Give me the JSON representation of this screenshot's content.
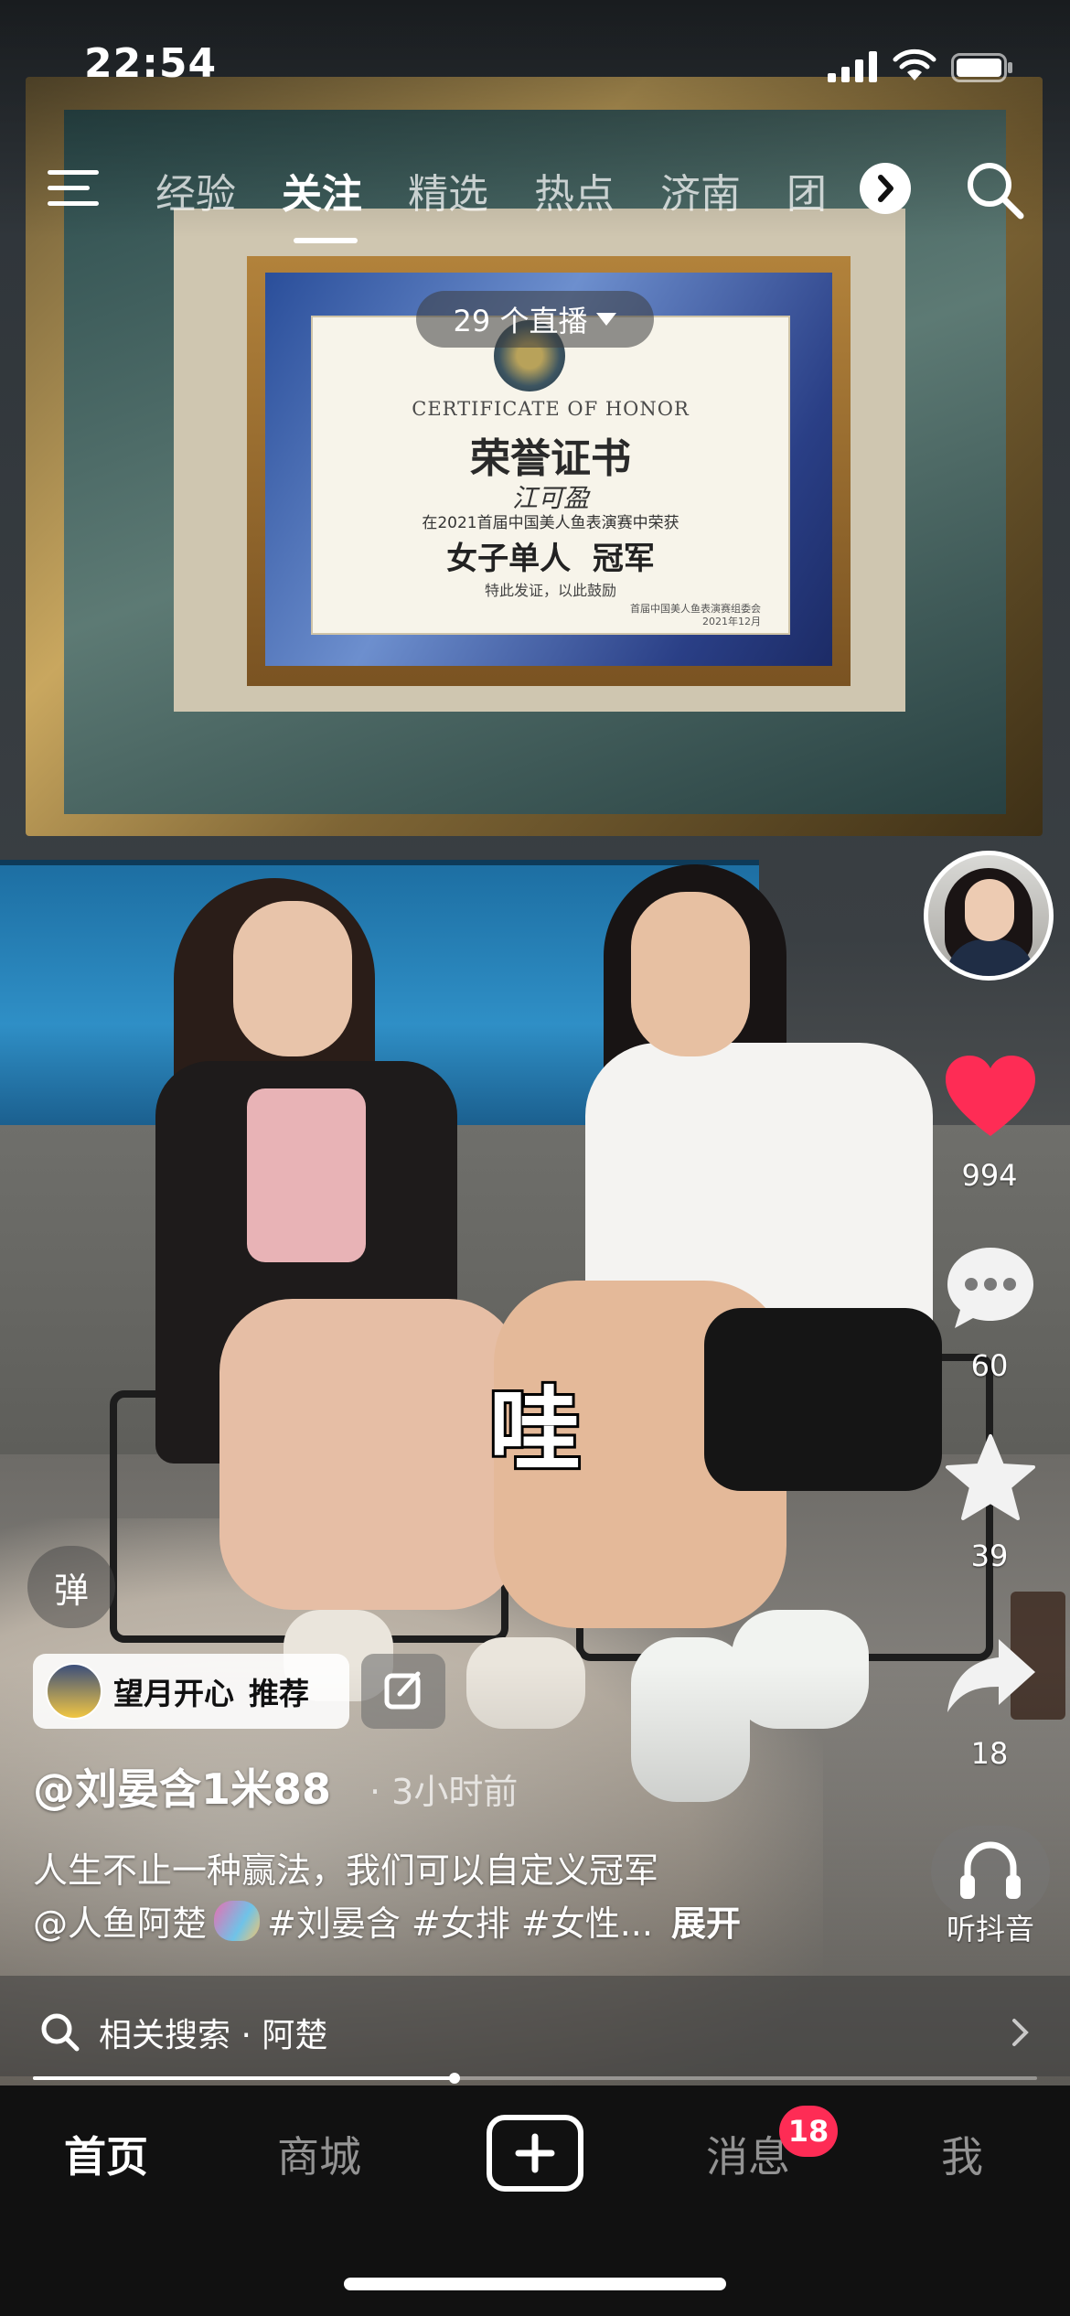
{
  "status_bar": {
    "time": "22:54"
  },
  "top_nav": {
    "tabs": [
      "经验",
      "关注",
      "精选",
      "热点",
      "济南",
      "团"
    ],
    "active_tab": "关注"
  },
  "live": {
    "label": "29 个直播"
  },
  "certificate": {
    "title_en": "CERTIFICATE OF HONOR",
    "title_cn": "荣誉证书",
    "name": "江可盈",
    "line1": "在2021首届中国美人鱼表演赛中荣获",
    "award": "女子单人  冠军",
    "line3": "特此发证，以此鼓励",
    "issuer": "首届中国美人鱼表演赛组委会",
    "date": "2021年12月"
  },
  "subtitle": "哇",
  "actions": {
    "likes": "994",
    "comments": "60",
    "favorites": "39",
    "shares": "18",
    "listen_label": "听抖音"
  },
  "danmu_label": "弹",
  "recommendation": {
    "name": "望月开心",
    "label": "推荐"
  },
  "post": {
    "author": "@刘晏含1米88",
    "time_ago": "· 3小时前",
    "caption_line1": "人生不止一种赢法，我们可以自定义冠军",
    "caption_mention": "@人鱼阿楚",
    "caption_tags": "#刘晏含 #女排 #女性...",
    "expand_label": "展开"
  },
  "related_search": {
    "label": "相关搜索 · 阿楚"
  },
  "progress": {
    "fraction": 0.42
  },
  "bottom_tabs": {
    "home": "首页",
    "mall": "商城",
    "messages": "消息",
    "messages_badge": "18",
    "me": "我"
  },
  "colors": {
    "like_red": "#fe2c55",
    "badge_red": "#fe2c55",
    "tabbar_bg": "#111111"
  },
  "icons": [
    "menu-icon",
    "search-icon",
    "heart-icon",
    "comment-icon",
    "star-icon",
    "share-icon",
    "headphones-icon",
    "edit-icon",
    "chevron-right-icon",
    "plus-icon"
  ]
}
